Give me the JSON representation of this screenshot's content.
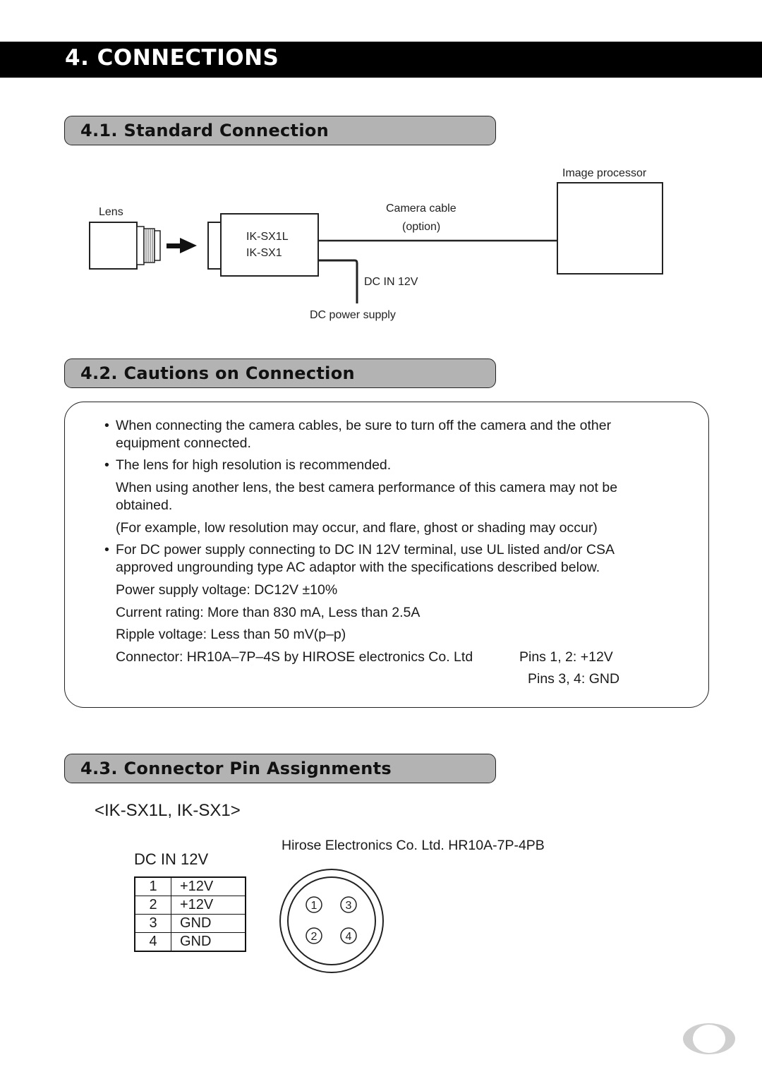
{
  "page": {
    "chapter_title": "4. CONNECTIONS",
    "page_badge_icon": "page-number-oval"
  },
  "section_1": {
    "title": "4.1. Standard Connection",
    "diagram": {
      "lens_label": "Lens",
      "camera_models": [
        "IK-SX1L",
        "IK-SX1"
      ],
      "cable_label_line1": "Camera cable",
      "cable_label_line2": "(option)",
      "processor_label": "Image processor",
      "dc_in_label": "DC IN 12V",
      "power_supply_label": "DC power supply"
    }
  },
  "section_2": {
    "title": "4.2. Cautions on Connection",
    "bullet_char": "•",
    "lines": [
      {
        "bullet": true,
        "text": "When connecting the camera cables, be sure to turn off the camera and the other"
      },
      {
        "bullet": false,
        "text": "equipment connected."
      },
      {
        "bullet": true,
        "text": "The lens for high resolution is recommended."
      },
      {
        "bullet": false,
        "text": "When using another lens, the best camera performance of this camera may not be"
      },
      {
        "bullet": false,
        "text": "obtained."
      },
      {
        "bullet": false,
        "text": "(For example, low resolution may occur, and flare, ghost or shading may occur)"
      },
      {
        "bullet": true,
        "text": "For DC power supply connecting to DC IN 12V terminal, use UL listed and/or CSA"
      },
      {
        "bullet": false,
        "text": "approved ungrounding type AC adaptor with the specifications described below."
      },
      {
        "bullet": false,
        "text": "Power supply voltage: DC12V  ±10%"
      },
      {
        "bullet": false,
        "text": "Current rating: More than 830 mA, Less than 2.5A"
      },
      {
        "bullet": false,
        "text": "Ripple voltage: Less than 50 mV(p–p)"
      },
      {
        "bullet": false,
        "text": "Connector: HR10A–7P–4S by HIROSE electronics Co. Ltd"
      }
    ],
    "pins_note_1": "Pins 1, 2: +12V",
    "pins_note_2": "Pins 3, 4: GND"
  },
  "section_3": {
    "title": "4.3. Connector Pin Assignments",
    "models": "<IK-SX1L, IK-SX1>",
    "table_title": "DC IN 12V",
    "connector_title": "Hirose Electronics Co. Ltd. HR10A-7P-4PB",
    "pins": [
      {
        "num": "1",
        "signal": "+12V"
      },
      {
        "num": "2",
        "signal": "+12V"
      },
      {
        "num": "3",
        "signal": "GND"
      },
      {
        "num": "4",
        "signal": "GND"
      }
    ],
    "connector_pin_labels": [
      "1",
      "3",
      "2",
      "4"
    ]
  }
}
